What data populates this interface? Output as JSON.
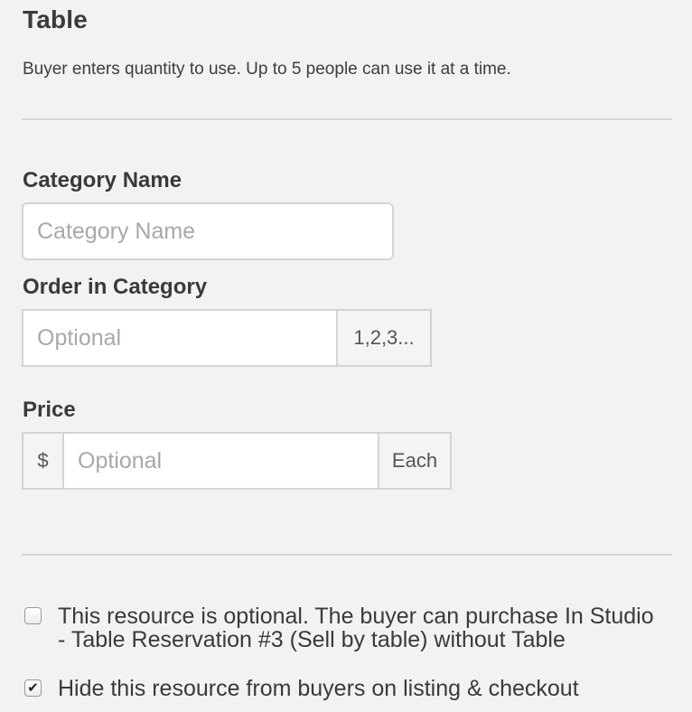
{
  "header": {
    "title": "Table",
    "description": "Buyer enters quantity to use. Up to 5 people can use it at a time."
  },
  "category_name": {
    "label": "Category Name",
    "placeholder": "Category Name",
    "value": ""
  },
  "order_in_category": {
    "label": "Order in Category",
    "placeholder": "Optional",
    "value": "",
    "addon": "1,2,3..."
  },
  "price": {
    "label": "Price",
    "currency": "$",
    "placeholder": "Optional",
    "value": "",
    "unit": "Each"
  },
  "options": {
    "optional_resource": {
      "checked": false,
      "label_line1": "This resource is optional. The buyer can purchase In Studio",
      "label_line2": "- Table Reservation #3 (Sell by table) without Table"
    },
    "hide_resource": {
      "checked": true,
      "label": "Hide this resource from buyers on listing & checkout"
    }
  }
}
